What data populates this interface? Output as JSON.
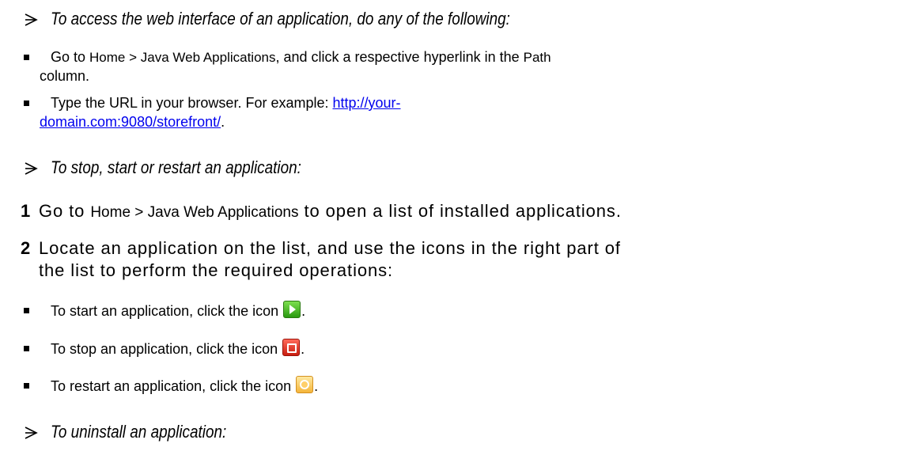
{
  "section1": {
    "heading": "To access the web interface of an application, do any of the following:",
    "bullet1": {
      "pre": "Go to ",
      "path": "Home > Java Web Applications",
      "mid": ", and click a respective hyperlink in the ",
      "col": "Path",
      "post": "column."
    },
    "bullet2": {
      "pre": "Type the URL in your browser. For example: ",
      "link_part1": "http://your-",
      "link_part2": "domain.com:9080/storefront/",
      "post": "."
    }
  },
  "section2": {
    "heading": "To stop, start or restart an application:",
    "step1": {
      "num": "1",
      "pre": "Go to ",
      "path": "Home > Java Web Applications",
      "post": " to open a list of installed applications."
    },
    "step2": {
      "num": "2",
      "line1": "Locate an application on the list, and use the icons in the right part of",
      "line2": "the list to perform the required operations:"
    },
    "bullets": [
      {
        "text": "To start an application, click the icon ",
        "icon": "start-icon",
        "post": "."
      },
      {
        "text": "To stop an application, click the icon ",
        "icon": "stop-icon",
        "post": "."
      },
      {
        "text": "To restart an application, click the icon ",
        "icon": "restart-icon",
        "post": "."
      }
    ]
  },
  "section3": {
    "heading": "To uninstall an application:"
  }
}
